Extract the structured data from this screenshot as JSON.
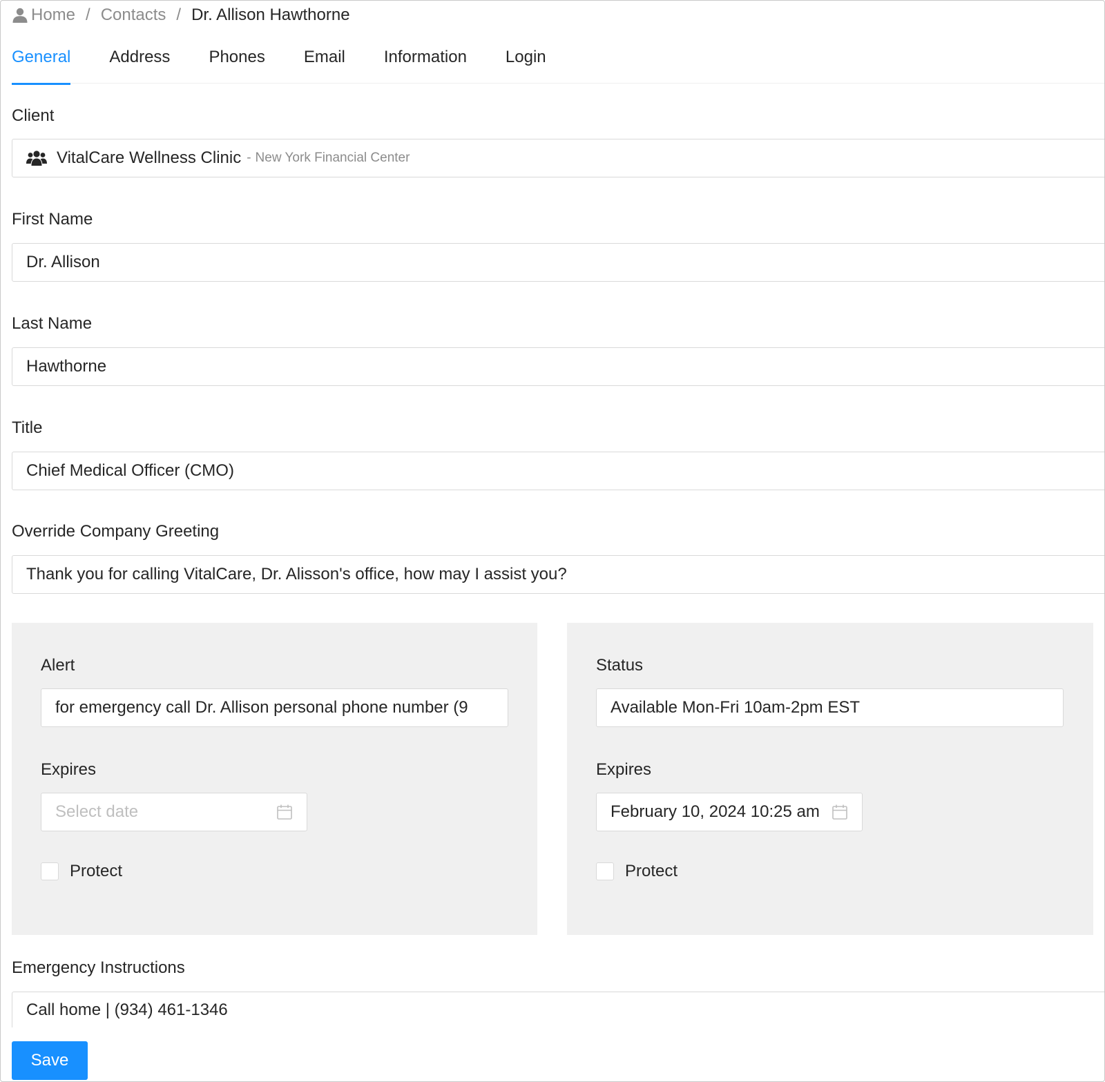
{
  "breadcrumb": {
    "icon": "user-icon",
    "items": [
      "Home",
      "Contacts"
    ],
    "current": "Dr. Allison Hawthorne",
    "separator": "/"
  },
  "tabs": [
    {
      "label": "General",
      "active": true
    },
    {
      "label": "Address",
      "active": false
    },
    {
      "label": "Phones",
      "active": false
    },
    {
      "label": "Email",
      "active": false
    },
    {
      "label": "Information",
      "active": false
    },
    {
      "label": "Login",
      "active": false
    }
  ],
  "form": {
    "client": {
      "label": "Client",
      "icon": "users-group-icon",
      "value": "VitalCare Wellness Clinic",
      "separator": "-",
      "location": "New York Financial Center"
    },
    "first_name": {
      "label": "First Name",
      "value": "Dr. Allison"
    },
    "last_name": {
      "label": "Last Name",
      "value": "Hawthorne"
    },
    "title": {
      "label": "Title",
      "value": "Chief Medical Officer (CMO)"
    },
    "greeting": {
      "label": "Override Company Greeting",
      "value": "Thank you for calling VitalCare, Dr. Alisson's office, how may I assist you?"
    },
    "alert": {
      "label": "Alert",
      "value": "for emergency call Dr. Allison personal phone number (9",
      "expires_label": "Expires",
      "expires_placeholder": "Select date",
      "protect_label": "Protect",
      "protect_checked": false
    },
    "status": {
      "label": "Status",
      "value": "Available Mon-Fri 10am-2pm EST",
      "expires_label": "Expires",
      "expires_value": "February 10, 2024 10:25 am",
      "protect_label": "Protect",
      "protect_checked": false
    },
    "emergency": {
      "label": "Emergency Instructions",
      "value": "Call home | (934) 461-1346"
    }
  },
  "actions": {
    "save_label": "Save"
  },
  "colors": {
    "accent": "#1890ff",
    "panel_bg": "#f0f0f0",
    "border": "#d9d9d9"
  }
}
